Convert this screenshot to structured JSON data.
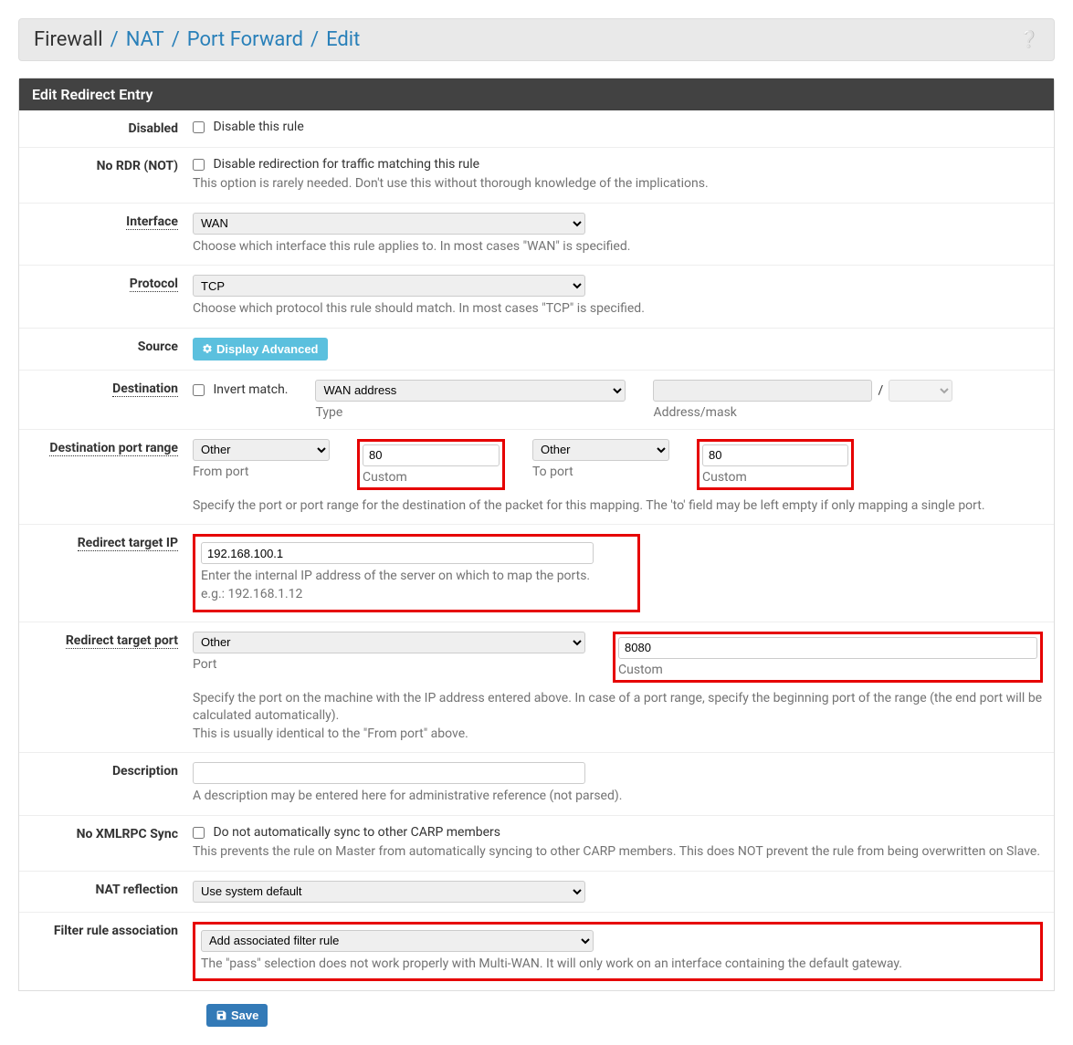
{
  "breadcrumb": {
    "firewall": "Firewall",
    "nat": "NAT",
    "port_forward": "Port Forward",
    "edit": "Edit"
  },
  "panel_title": "Edit Redirect Entry",
  "labels": {
    "disabled": "Disabled",
    "no_rdr": "No RDR (NOT)",
    "interface": "Interface",
    "protocol": "Protocol",
    "source": "Source",
    "destination": "Destination",
    "dest_port_range": "Destination port range",
    "redirect_ip": "Redirect target IP",
    "redirect_port": "Redirect target port",
    "description": "Description",
    "no_xmlrpc": "No XMLRPC Sync",
    "nat_reflection": "NAT reflection",
    "filter_assoc": "Filter rule association"
  },
  "fields": {
    "disabled_check": "Disable this rule",
    "no_rdr_check": "Disable redirection for traffic matching this rule",
    "no_rdr_help": "This option is rarely needed. Don't use this without thorough knowledge of the implications.",
    "interface_value": "WAN",
    "interface_help": "Choose which interface this rule applies to. In most cases \"WAN\" is specified.",
    "protocol_value": "TCP",
    "protocol_help": "Choose which protocol this rule should match. In most cases \"TCP\" is specified.",
    "display_advanced": "Display Advanced",
    "invert_match": "Invert match.",
    "dest_type_value": "WAN address",
    "dest_type_label": "Type",
    "dest_addr_slash": "/",
    "dest_addr_label": "Address/mask",
    "from_port_sel": "Other",
    "from_port_label": "From port",
    "from_custom_val": "80",
    "from_custom_label": "Custom",
    "to_port_sel": "Other",
    "to_port_label": "To port",
    "to_custom_val": "80",
    "to_custom_label": "Custom",
    "port_range_help": "Specify the port or port range for the destination of the packet for this mapping. The 'to' field may be left empty if only mapping a single port.",
    "redirect_ip_val": "192.168.100.1",
    "redirect_ip_help1": "Enter the internal IP address of the server on which to map the ports.",
    "redirect_ip_help2": "e.g.: 192.168.1.12",
    "redirect_port_sel": "Other",
    "redirect_port_label": "Port",
    "redirect_custom_val": "8080",
    "redirect_custom_label": "Custom",
    "redirect_port_help1": "Specify the port on the machine with the IP address entered above. In case of a port range, specify the beginning port of the range (the end port will be calculated automatically).",
    "redirect_port_help2": "This is usually identical to the \"From port\" above.",
    "description_val": "",
    "description_help": "A description may be entered here for administrative reference (not parsed).",
    "no_xmlrpc_check": "Do not automatically sync to other CARP members",
    "no_xmlrpc_help": "This prevents the rule on Master from automatically syncing to other CARP members. This does NOT prevent the rule from being overwritten on Slave.",
    "nat_reflection_val": "Use system default",
    "filter_assoc_val": "Add associated filter rule",
    "filter_assoc_help": "The \"pass\" selection does not work properly with Multi-WAN. It will only work on an interface containing the default gateway."
  },
  "save_btn": "Save"
}
